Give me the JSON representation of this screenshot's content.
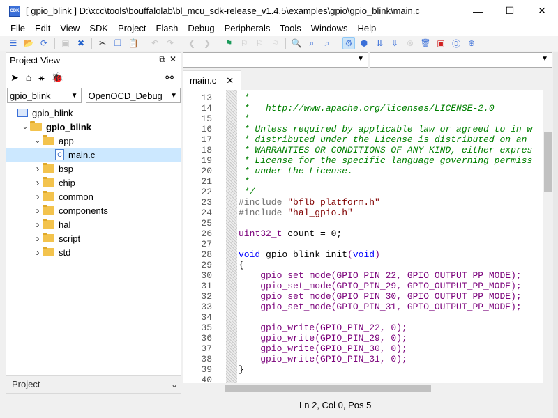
{
  "window": {
    "title": "[ gpio_blink ] D:\\xcc\\tools\\bouffalolab\\bl_mcu_sdk-release_v1.4.5\\examples\\gpio\\gpio_blink\\main.c",
    "app_icon_text": "CDK",
    "minimize": "—",
    "maximize": "☐",
    "close": "✕"
  },
  "menu": [
    "File",
    "Edit",
    "View",
    "SDK",
    "Project",
    "Flash",
    "Debug",
    "Peripherals",
    "Tools",
    "Windows",
    "Help"
  ],
  "toolbar": {
    "icons": [
      {
        "name": "new-icon",
        "glyph": "☰",
        "color": "#3a6fd8"
      },
      {
        "name": "open-folder-icon",
        "glyph": "📂",
        "color": "#e0a92a"
      },
      {
        "name": "reload-icon",
        "glyph": "⟳",
        "color": "#3a6fd8"
      },
      {
        "name": "save-icon",
        "glyph": "▣",
        "color": "#7a7a7a",
        "disabled": true
      },
      {
        "name": "close-icon",
        "glyph": "✖",
        "color": "#1e5fcc"
      },
      {
        "name": "cut-icon",
        "glyph": "✂",
        "color": "#333"
      },
      {
        "name": "copy-icon",
        "glyph": "❐",
        "color": "#3a6fd8"
      },
      {
        "name": "paste-icon",
        "glyph": "📋",
        "color": "#3a6fd8"
      },
      {
        "name": "undo-icon",
        "glyph": "↶",
        "color": "#777",
        "disabled": true
      },
      {
        "name": "redo-icon",
        "glyph": "↷",
        "color": "#777",
        "disabled": true
      },
      {
        "name": "back-icon",
        "glyph": "❮",
        "color": "#777",
        "disabled": true
      },
      {
        "name": "forward-icon",
        "glyph": "❯",
        "color": "#777",
        "disabled": true
      },
      {
        "name": "flag-icon",
        "glyph": "⚑",
        "color": "#1a9a5a"
      },
      {
        "name": "bookmark-prev-icon",
        "glyph": "⚐",
        "color": "#777",
        "disabled": true
      },
      {
        "name": "bookmark-next-icon",
        "glyph": "⚐",
        "color": "#777",
        "disabled": true
      },
      {
        "name": "bookmark-clear-icon",
        "glyph": "⚐",
        "color": "#777",
        "disabled": true
      },
      {
        "name": "find-icon",
        "glyph": "🔍",
        "color": "#3a6fd8"
      },
      {
        "name": "find-in-files-icon",
        "glyph": "⌕",
        "color": "#3a6fd8"
      },
      {
        "name": "find-replace-icon",
        "glyph": "⌕",
        "color": "#3a6fd8"
      },
      {
        "name": "build-config-icon",
        "glyph": "⚙",
        "color": "#3a6fd8",
        "active": true
      },
      {
        "name": "build-icon",
        "glyph": "⬢",
        "color": "#3a6fd8"
      },
      {
        "name": "rebuild-icon",
        "glyph": "⇊",
        "color": "#3a6fd8"
      },
      {
        "name": "download-icon",
        "glyph": "⇩",
        "color": "#3a6fd8"
      },
      {
        "name": "stop-icon",
        "glyph": "⊗",
        "color": "#999",
        "disabled": true
      },
      {
        "name": "clean-icon",
        "glyph": "🗑",
        "color": "#3a6fd8"
      },
      {
        "name": "debug-icon",
        "glyph": "▣",
        "color": "#d02020"
      },
      {
        "name": "start-debug-icon",
        "glyph": "Ⓓ",
        "color": "#3a6fd8"
      },
      {
        "name": "zoom-icon",
        "glyph": "⊕",
        "color": "#3a6fd8"
      }
    ]
  },
  "project_view": {
    "title": "Project View",
    "tools": [
      "navigate-icon",
      "home-icon",
      "tree-icon",
      "bug-icon"
    ],
    "link_icon": "link-icon",
    "project_select": "gpio_blink",
    "config_select": "OpenOCD_Debug",
    "tree": [
      {
        "label": "gpio_blink",
        "level": 0,
        "type": "project",
        "expanded": false,
        "chevron": ""
      },
      {
        "label": "gpio_blink",
        "level": 1,
        "type": "folder",
        "bold": true,
        "chevron": "v"
      },
      {
        "label": "app",
        "level": 2,
        "type": "folder",
        "chevron": "v"
      },
      {
        "label": "main.c",
        "level": 3,
        "type": "file",
        "selected": true,
        "chevron": ""
      },
      {
        "label": "bsp",
        "level": 2,
        "type": "folder",
        "chevron": ">"
      },
      {
        "label": "chip",
        "level": 2,
        "type": "folder",
        "chevron": ">"
      },
      {
        "label": "common",
        "level": 2,
        "type": "folder",
        "chevron": ">"
      },
      {
        "label": "components",
        "level": 2,
        "type": "folder",
        "chevron": ">"
      },
      {
        "label": "hal",
        "level": 2,
        "type": "folder",
        "chevron": ">"
      },
      {
        "label": "script",
        "level": 2,
        "type": "folder",
        "chevron": ">"
      },
      {
        "label": "std",
        "level": 2,
        "type": "folder",
        "chevron": ">"
      }
    ],
    "bottom_tab": "Project"
  },
  "editor": {
    "tab_label": "main.c",
    "tab_close": "✕",
    "lines": [
      {
        "n": "13",
        "parts": [
          {
            "t": " *",
            "c": "cmt"
          }
        ]
      },
      {
        "n": "14",
        "parts": [
          {
            "t": " *   http://www.apache.org/licenses/LICENSE-2.0",
            "c": "cmt"
          }
        ]
      },
      {
        "n": "15",
        "parts": [
          {
            "t": " *",
            "c": "cmt"
          }
        ]
      },
      {
        "n": "16",
        "parts": [
          {
            "t": " * Unless required by applicable law or agreed to in w",
            "c": "cmt"
          }
        ]
      },
      {
        "n": "17",
        "parts": [
          {
            "t": " * distributed under the License is distributed on an",
            "c": "cmt"
          }
        ]
      },
      {
        "n": "18",
        "parts": [
          {
            "t": " * WARRANTIES OR CONDITIONS OF ANY KIND, either expres",
            "c": "cmt"
          }
        ]
      },
      {
        "n": "19",
        "parts": [
          {
            "t": " * License for the specific language governing permiss",
            "c": "cmt"
          }
        ]
      },
      {
        "n": "20",
        "parts": [
          {
            "t": " * under the License.",
            "c": "cmt"
          }
        ]
      },
      {
        "n": "21",
        "parts": [
          {
            "t": " *",
            "c": "cmt"
          }
        ]
      },
      {
        "n": "22",
        "parts": [
          {
            "t": " */",
            "c": "cmt"
          }
        ]
      },
      {
        "n": "23",
        "parts": [
          {
            "t": "#include ",
            "c": "pp"
          },
          {
            "t": "\"bflb_platform.h\"",
            "c": "str"
          }
        ]
      },
      {
        "n": "24",
        "parts": [
          {
            "t": "#include ",
            "c": "pp"
          },
          {
            "t": "\"hal_gpio.h\"",
            "c": "str"
          }
        ]
      },
      {
        "n": "25",
        "parts": [
          {
            "t": "",
            "c": "def"
          }
        ]
      },
      {
        "n": "26",
        "parts": [
          {
            "t": "uint32_t",
            "c": "fn"
          },
          {
            "t": " count = 0;",
            "c": "def"
          }
        ]
      },
      {
        "n": "27",
        "parts": [
          {
            "t": "",
            "c": "def"
          }
        ]
      },
      {
        "n": "28",
        "parts": [
          {
            "t": "void",
            "c": "kw"
          },
          {
            "t": " gpio_blink_init",
            "c": "def"
          },
          {
            "t": "(",
            "c": "fn"
          },
          {
            "t": "void",
            "c": "kw"
          },
          {
            "t": ")",
            "c": "fn"
          }
        ]
      },
      {
        "n": "29",
        "parts": [
          {
            "t": "{",
            "c": "def"
          }
        ]
      },
      {
        "n": "30",
        "parts": [
          {
            "t": "    gpio_set_mode(GPIO_PIN_22, GPIO_OUTPUT_PP_MODE);",
            "c": "fn"
          }
        ]
      },
      {
        "n": "31",
        "parts": [
          {
            "t": "    gpio_set_mode(GPIO_PIN_29, GPIO_OUTPUT_PP_MODE);",
            "c": "fn"
          }
        ]
      },
      {
        "n": "32",
        "parts": [
          {
            "t": "    gpio_set_mode(GPIO_PIN_30, GPIO_OUTPUT_PP_MODE);",
            "c": "fn"
          }
        ]
      },
      {
        "n": "33",
        "parts": [
          {
            "t": "    gpio_set_mode(GPIO_PIN_31, GPIO_OUTPUT_PP_MODE);",
            "c": "fn"
          }
        ]
      },
      {
        "n": "34",
        "parts": [
          {
            "t": "",
            "c": "def"
          }
        ]
      },
      {
        "n": "35",
        "parts": [
          {
            "t": "    gpio_write(GPIO_PIN_22, 0);",
            "c": "fn"
          }
        ]
      },
      {
        "n": "36",
        "parts": [
          {
            "t": "    gpio_write(GPIO_PIN_29, 0);",
            "c": "fn"
          }
        ]
      },
      {
        "n": "37",
        "parts": [
          {
            "t": "    gpio_write(GPIO_PIN_30, 0);",
            "c": "fn"
          }
        ]
      },
      {
        "n": "38",
        "parts": [
          {
            "t": "    gpio_write(GPIO_PIN_31, 0);",
            "c": "fn"
          }
        ]
      },
      {
        "n": "39",
        "parts": [
          {
            "t": "}",
            "c": "def"
          }
        ]
      },
      {
        "n": "40",
        "parts": [
          {
            "t": "",
            "c": "def"
          }
        ]
      }
    ]
  },
  "status": {
    "position": "Ln 2, Col 0, Pos 5"
  }
}
